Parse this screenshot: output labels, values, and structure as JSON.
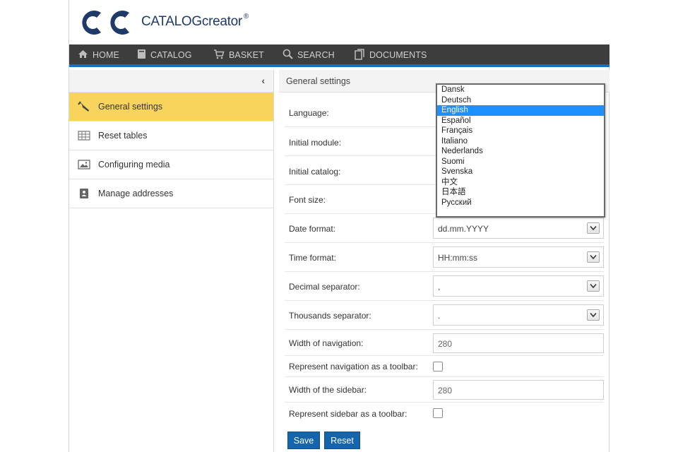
{
  "brand": {
    "logo_text": "CATALOGcreator",
    "logo_mark": "®"
  },
  "nav": [
    {
      "label": "HOME",
      "icon": "home-icon"
    },
    {
      "label": "CATALOG",
      "icon": "book-icon"
    },
    {
      "label": "BASKET",
      "icon": "cart-icon"
    },
    {
      "label": "SEARCH",
      "icon": "search-icon"
    },
    {
      "label": "DOCUMENTS",
      "icon": "documents-icon"
    }
  ],
  "sidebar": {
    "collapse_symbol": "‹",
    "items": [
      {
        "label": "General settings",
        "icon": "wrench-icon",
        "active": true
      },
      {
        "label": "Reset tables",
        "icon": "table-icon",
        "active": false
      },
      {
        "label": "Configuring media",
        "icon": "image-icon",
        "active": false
      },
      {
        "label": "Manage addresses",
        "icon": "address-book-icon",
        "active": false
      }
    ]
  },
  "main": {
    "title": "General settings",
    "fields": {
      "language": {
        "label": "Language:"
      },
      "initial_module": {
        "label": "Initial module:"
      },
      "initial_catalog": {
        "label": "Initial catalog:"
      },
      "font_size": {
        "label": "Font size:"
      },
      "date_format": {
        "label": "Date format:",
        "value": "dd.mm.YYYY"
      },
      "time_format": {
        "label": "Time format:",
        "value": "HH:mm:ss"
      },
      "decimal_separator": {
        "label": "Decimal separator:",
        "value": ","
      },
      "thousands_separator": {
        "label": "Thousands separator:",
        "value": "."
      },
      "nav_width": {
        "label": "Width of navigation:",
        "value": "280"
      },
      "nav_toolbar": {
        "label": "Represent navigation as a toolbar:",
        "checked": false
      },
      "sidebar_width": {
        "label": "Width of the sidebar:",
        "value": "280"
      },
      "sidebar_toolbar": {
        "label": "Represent sidebar as a toolbar:",
        "checked": false
      }
    },
    "buttons": {
      "save": "Save",
      "reset": "Reset"
    }
  },
  "language_dropdown": {
    "selected": "English",
    "options": [
      "Dansk",
      "Deutsch",
      "English",
      "Español",
      "Français",
      "Italiano",
      "Nederlands",
      "Suomi",
      "Svenska",
      "中文",
      "日本語",
      "Русский"
    ]
  },
  "colors": {
    "nav_bg": "#3d3d3d",
    "nav_accent": "#1a6fb7",
    "active_item": "#f9d45c",
    "button": "#1565ac",
    "selected_option": "#1e90ff",
    "logo": "#1f3a68"
  }
}
